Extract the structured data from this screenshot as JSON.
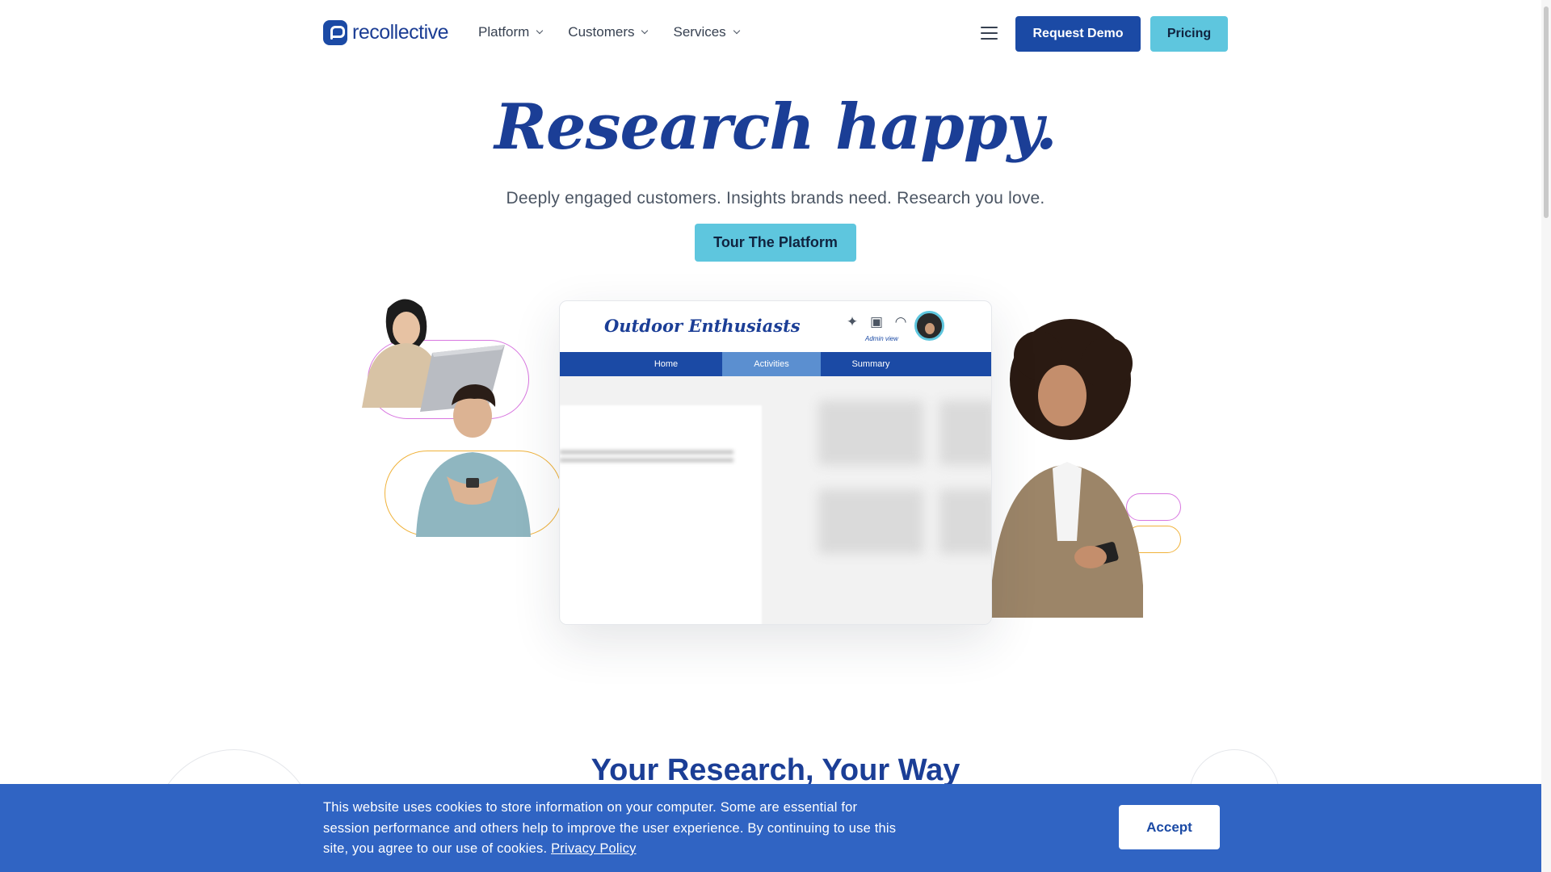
{
  "brand": {
    "name": "recollective",
    "primary": "#1b4aa5",
    "accent": "#5ec6de"
  },
  "header": {
    "nav": [
      {
        "label": "Platform"
      },
      {
        "label": "Customers"
      },
      {
        "label": "Services"
      }
    ],
    "menu_icon": "hamburger-icon",
    "request_demo": "Request Demo",
    "pricing": "Pricing"
  },
  "hero": {
    "title": "Research happy.",
    "subtitle": "Deeply engaged customers. Insights brands need. Research you love.",
    "cta": "Tour The Platform"
  },
  "mockup": {
    "title": "Outdoor Enthusiasts",
    "icons": [
      "sparkle-icon",
      "photos-icon",
      "bell-icon"
    ],
    "admin_label": "Admin view",
    "tabs": [
      {
        "label": "Home",
        "active": false
      },
      {
        "label": "Activities",
        "active": true
      },
      {
        "label": "Summary",
        "active": false
      }
    ]
  },
  "section": {
    "title": "Your Research, Your Way"
  },
  "cookie": {
    "text": "This website uses cookies to store information on your computer. Some are essential for session performance and others help to improve the user experience. By continuing to use this site, you agree to our use of cookies.",
    "link": "Privacy Policy",
    "accept": "Accept"
  }
}
